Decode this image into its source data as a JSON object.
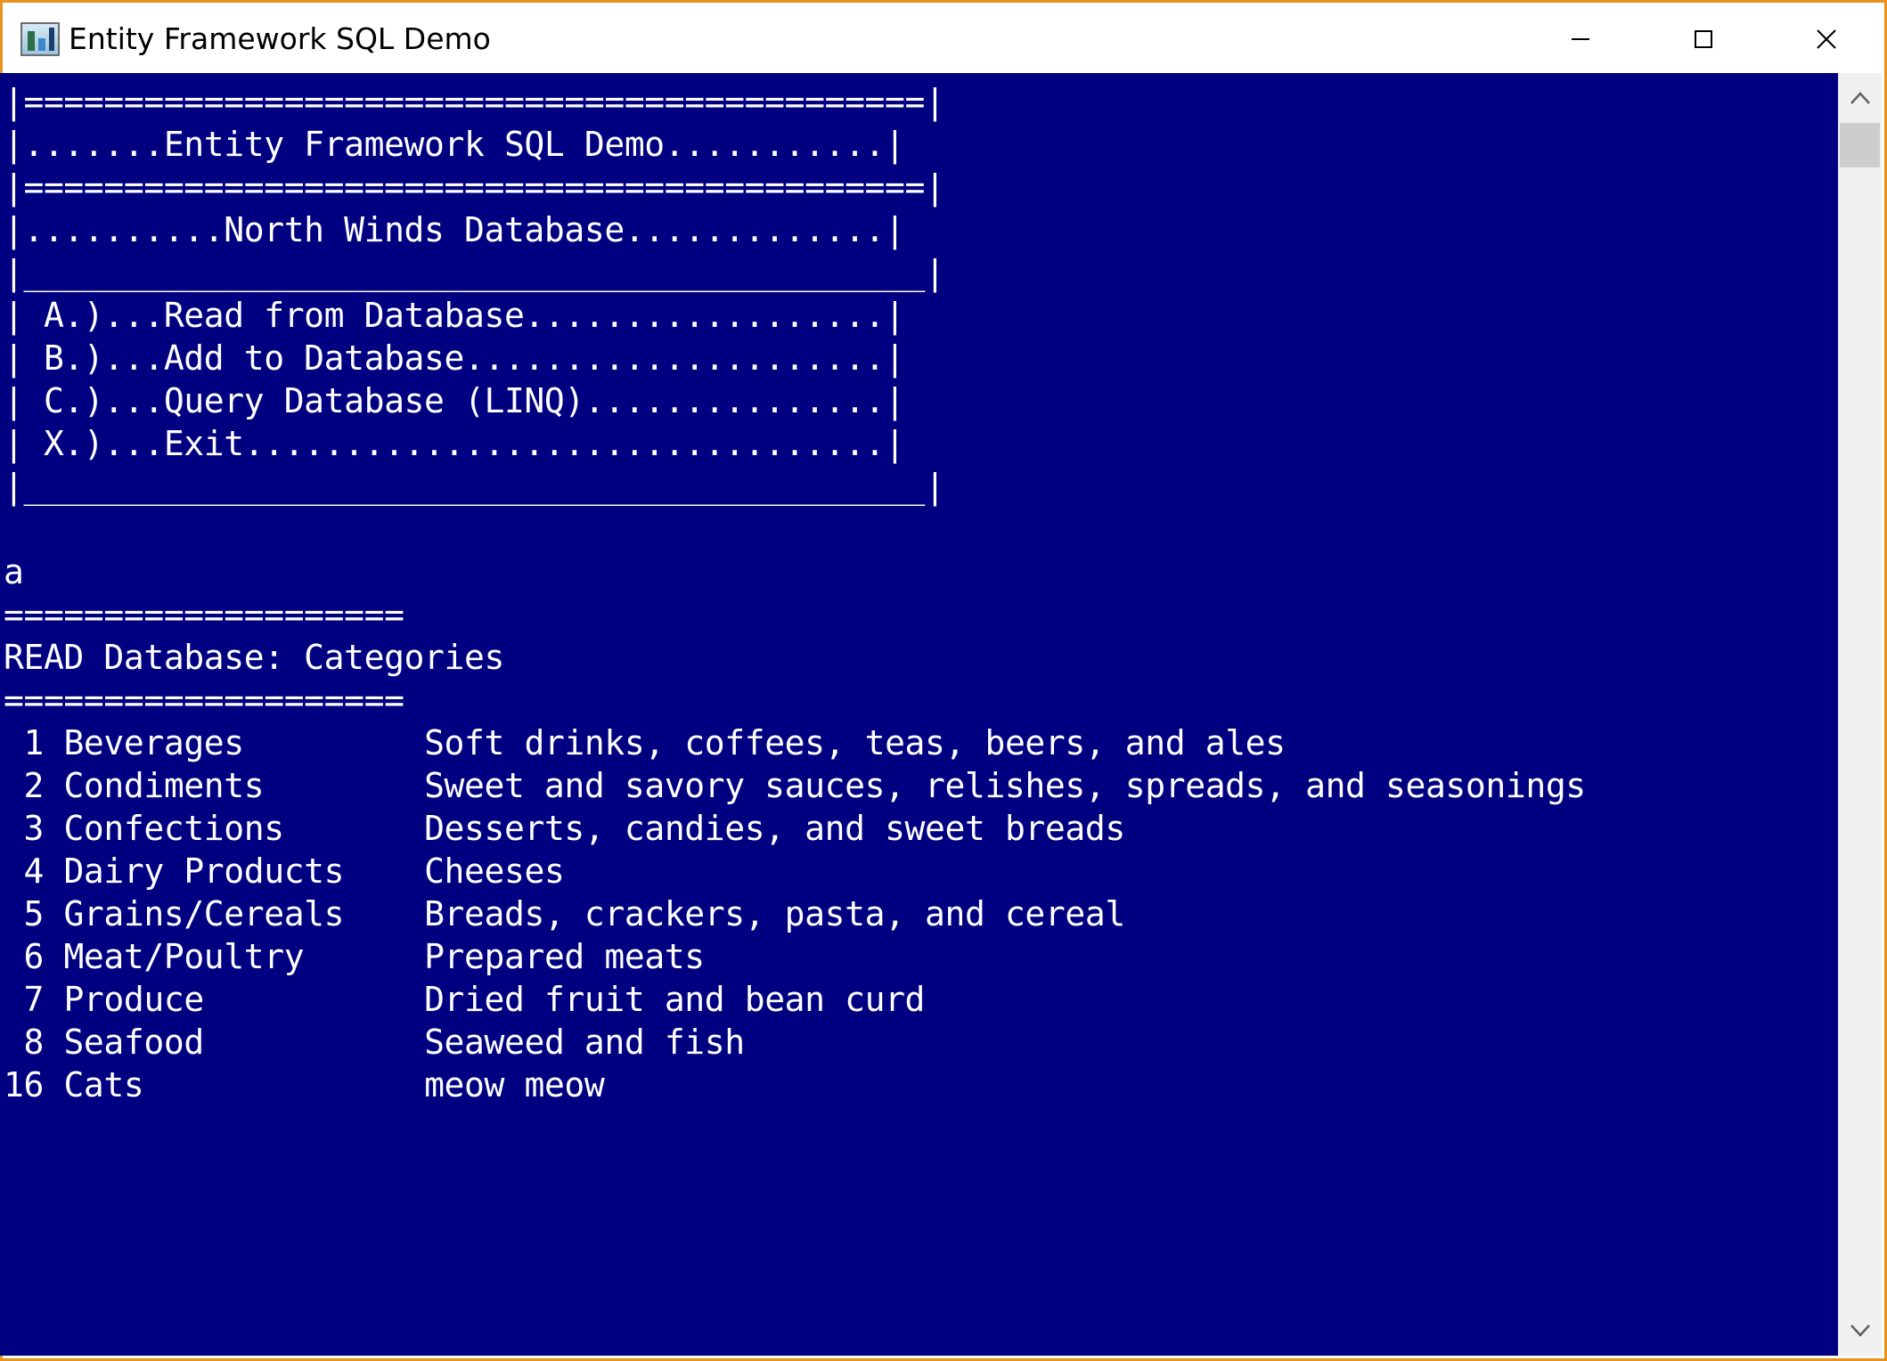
{
  "window": {
    "title": "Entity Framework SQL Demo",
    "accent_border": "#e8931f",
    "icons": {
      "app": "console-app-icon",
      "minimize": "minimize-icon",
      "maximize": "maximize-icon",
      "close": "close-icon",
      "scroll_up": "chevron-up-icon",
      "scroll_down": "chevron-down-icon"
    }
  },
  "console": {
    "background": "#000080",
    "foreground": "#ffffff",
    "menu_lines": [
      "|=============================================|",
      "|.......Entity Framework SQL Demo...........|",
      "|=============================================|",
      "|..........North Winds Database.............|",
      "|_____________________________________________|",
      "| A.)...Read from Database..................|",
      "| B.)...Add to Database.....................|",
      "| C.)...Query Database (LINQ)...............|",
      "| X.)...Exit................................|",
      "|_____________________________________________|"
    ],
    "user_input": "a",
    "separator": "====================",
    "read_header": "READ Database: Categories",
    "categories": [
      {
        "id": " 1",
        "name": "Beverages",
        "description": "Soft drinks, coffees, teas, beers, and ales"
      },
      {
        "id": " 2",
        "name": "Condiments",
        "description": "Sweet and savory sauces, relishes, spreads, and seasonings"
      },
      {
        "id": " 3",
        "name": "Confections",
        "description": "Desserts, candies, and sweet breads"
      },
      {
        "id": " 4",
        "name": "Dairy Products",
        "description": "Cheeses"
      },
      {
        "id": " 5",
        "name": "Grains/Cereals",
        "description": "Breads, crackers, pasta, and cereal"
      },
      {
        "id": " 6",
        "name": "Meat/Poultry",
        "description": "Prepared meats"
      },
      {
        "id": " 7",
        "name": "Produce",
        "description": "Dried fruit and bean curd"
      },
      {
        "id": " 8",
        "name": "Seafood",
        "description": "Seaweed and fish"
      },
      {
        "id": "16",
        "name": "Cats",
        "description": "meow meow"
      }
    ]
  }
}
